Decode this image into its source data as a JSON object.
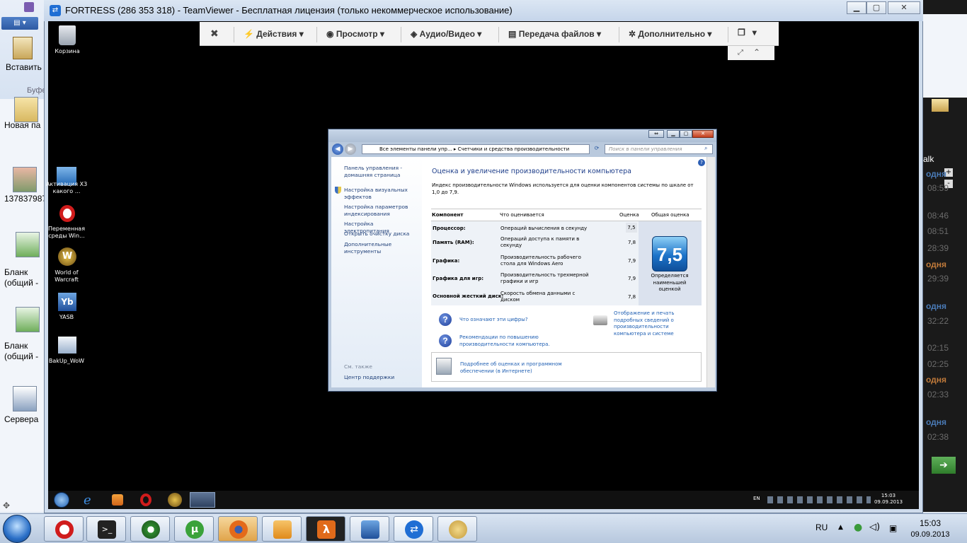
{
  "background_app": {
    "paste_label": "Вставить",
    "clipboard_group": "Буфе",
    "desktop_items": [
      "Новая па",
      "137837987",
      "Бланк (общий -",
      "Бланк (общий -",
      "Сервера"
    ],
    "right_panel": {
      "alk": "alk",
      "entries": [
        {
          "kind": "today",
          "text": "одня"
        },
        {
          "kind": "time",
          "text": "08:59"
        },
        {
          "kind": "time",
          "text": "08:46"
        },
        {
          "kind": "time",
          "text": "08:51"
        },
        {
          "kind": "time",
          "text": "28:39"
        },
        {
          "kind": "today",
          "text": "одня"
        },
        {
          "kind": "time",
          "text": "29:39"
        },
        {
          "kind": "today",
          "text": "одня"
        },
        {
          "kind": "time",
          "text": "32:22"
        },
        {
          "kind": "time",
          "text": "02:15"
        },
        {
          "kind": "time",
          "text": "02:25"
        },
        {
          "kind": "today",
          "text": "одня"
        },
        {
          "kind": "time",
          "text": "02:33"
        },
        {
          "kind": "today",
          "text": "одня"
        },
        {
          "kind": "time",
          "text": "02:38"
        }
      ]
    }
  },
  "teamviewer": {
    "title": "FORTRESS (286 353 318) - TeamViewer - Бесплатная лицензия (только некоммерческое использование)",
    "toolbar": [
      "Действия",
      "Просмотр",
      "Аудио/Видео",
      "Передача файлов",
      "Дополнительно"
    ]
  },
  "remote_desktop": {
    "icons": [
      {
        "label": "Корзина",
        "icon": "recycle-bin-icon"
      },
      {
        "label": "Активация Х3 какого ...",
        "icon": "activation-icon"
      },
      {
        "label": "Переменная среды Win...",
        "icon": "opera-icon"
      },
      {
        "label": "World of Warcraft",
        "icon": "wow-icon"
      },
      {
        "label": "YASB",
        "icon": "yasb-icon"
      },
      {
        "label": "BakUp_WoW",
        "icon": "backup-icon"
      }
    ],
    "tray_lang": "EN",
    "clock_time": "15:03",
    "clock_date": "09.09.2013"
  },
  "control_panel": {
    "address": "Все элементы панели упр...  ▸  Счетчики и средства производительности",
    "search_placeholder": "Поиск в панели управления",
    "left_links": [
      "Панель управления - домашняя страница",
      "Настройка визуальных эффектов",
      "Настройка параметров индексирования",
      "Настройка электропитания",
      "Открыть очистку диска",
      "Дополнительные инструменты"
    ],
    "see_also": "См. также",
    "action_center": "Центр поддержки",
    "heading": "Оценка и увеличение производительности компьютера",
    "description": "Индекс производительности Windows используется для оценки компонентов системы по шкале от 1,0 до 7,9.",
    "columns": {
      "component": "Компонент",
      "what": "Что оценивается",
      "score": "Оценка",
      "base": "Общая оценка"
    },
    "rows": [
      {
        "component": "Процессор:",
        "what": "Операций вычисления в секунду",
        "score": "7,5"
      },
      {
        "component": "Память (RAM):",
        "what": "Операций доступа к памяти в секунду",
        "score": "7,8"
      },
      {
        "component": "Графика:",
        "what": "Производительность рабочего стола для Windows Aero",
        "score": "7,9"
      },
      {
        "component": "Графика для игр:",
        "what": "Производительность трехмерной графики и игр",
        "score": "7,9"
      },
      {
        "component": "Основной жесткий диск:",
        "what": "Скорость обмена данными с диском",
        "score": "7,8"
      }
    ],
    "base_score": "7,5",
    "base_caption": "Определяется наименьшей оценкой",
    "help_what": "Что означают эти цифры?",
    "help_tips": "Рекомендации по повышению производительности компьютера.",
    "print_details": "Отображение и печать подробных сведений о производительности компьютера и системе",
    "online_info": "Подробнее об оценках и программном обеспечении (в Интернете)"
  },
  "taskbar": {
    "lang": "RU",
    "time": "15:03",
    "date": "09.09.2013"
  }
}
